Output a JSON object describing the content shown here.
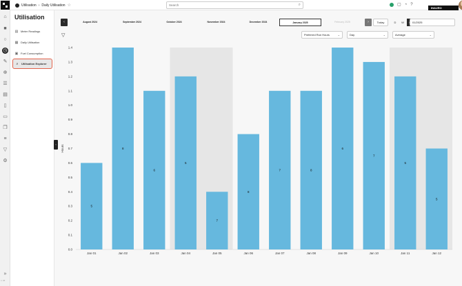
{
  "header": {
    "breadcrumb": [
      "Utilisation",
      "Daily Utilisation"
    ],
    "search_placeholder": "Search",
    "brand": "INAURO"
  },
  "sidebar": {
    "title": "Utilisation",
    "items": [
      {
        "label": "Meter Readings",
        "icon": "clipboard-icon"
      },
      {
        "label": "Daily Utilisation",
        "icon": "calendar-icon"
      },
      {
        "label": "Fuel Consumption",
        "icon": "fuel-icon"
      },
      {
        "label": "Utilisation Explorer",
        "icon": "magnifier-icon",
        "selected": true
      }
    ]
  },
  "period_nav": {
    "prev": "‹",
    "next": "›",
    "months": [
      "August 2024",
      "September 2024",
      "October 2024",
      "November 2024",
      "December 2024",
      "January 2025",
      "February 2025"
    ],
    "selected_month": "January 2025",
    "today_label": "Today",
    "views": [
      "D",
      "W",
      "M"
    ],
    "selected_view": "M",
    "date_value": "01/2025"
  },
  "filters": {
    "metric": "Preferred Run Hours",
    "interval": "Day",
    "aggregation": "Average"
  },
  "colors": {
    "bar": "#66b8de",
    "weekend_band": "#e6e6e6",
    "selected_outline": "#e0624a"
  },
  "version": "v. 24",
  "chart_data": {
    "type": "bar",
    "categories": [
      "Jan 01",
      "Jan 02",
      "Jan 03",
      "Jan 04",
      "Jan 05",
      "Jan 06",
      "Jan 07",
      "Jan 08",
      "Jan 09",
      "Jan 10",
      "Jan 11",
      "Jan 12"
    ],
    "values": [
      0.6,
      1.4,
      1.1,
      1.2,
      0.4,
      0.8,
      1.1,
      1.1,
      1.4,
      1.3,
      1.2,
      0.7
    ],
    "data_labels": [
      "5",
      "8",
      "6",
      "5",
      "7",
      "8",
      "7",
      "8",
      "6",
      "7",
      "5",
      "5"
    ],
    "shaded_categories": [
      "Jan 04",
      "Jan 05",
      "Jan 11",
      "Jan 12"
    ],
    "ylabel": "Hours",
    "ylim": [
      0,
      1.4
    ],
    "yticks": [
      0,
      0.1,
      0.2,
      0.3,
      0.4,
      0.5,
      0.6,
      0.7,
      0.8,
      0.9,
      1.0,
      1.1,
      1.2,
      1.3,
      1.4
    ]
  }
}
